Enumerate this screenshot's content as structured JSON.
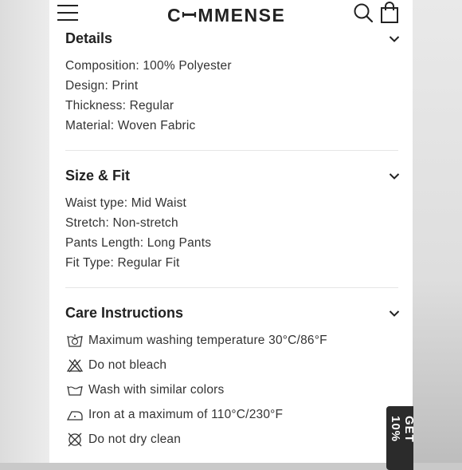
{
  "header": {
    "brand": "CꟷMMENSE"
  },
  "details": {
    "title": "Details",
    "lines": [
      "Composition: 100% Polyester",
      "Design: Print",
      "Thickness: Regular",
      "Material: Woven Fabric"
    ]
  },
  "size_fit": {
    "title": "Size & Fit",
    "lines": [
      "Waist type: Mid Waist",
      "Stretch: Non-stretch",
      "Pants Length: Long Pants",
      "Fit Type: Regular Fit"
    ]
  },
  "care": {
    "title": "Care Instructions",
    "items": [
      {
        "icon": "wash-30-icon",
        "text": "Maximum washing temperature 30°C/86°F"
      },
      {
        "icon": "no-bleach-icon",
        "text": "Do not bleach"
      },
      {
        "icon": "wash-tub-icon",
        "text": "Wash with similar colors"
      },
      {
        "icon": "iron-icon",
        "text": "Iron at a maximum of 110°C/230°F"
      },
      {
        "icon": "no-dry-clean-icon",
        "text": "Do not dry clean"
      }
    ]
  },
  "promo": {
    "label": "GET 10%"
  },
  "colors": {
    "text": "#222222",
    "divider": "#e6e6e6",
    "promo_bg": "#2b2b2b"
  }
}
